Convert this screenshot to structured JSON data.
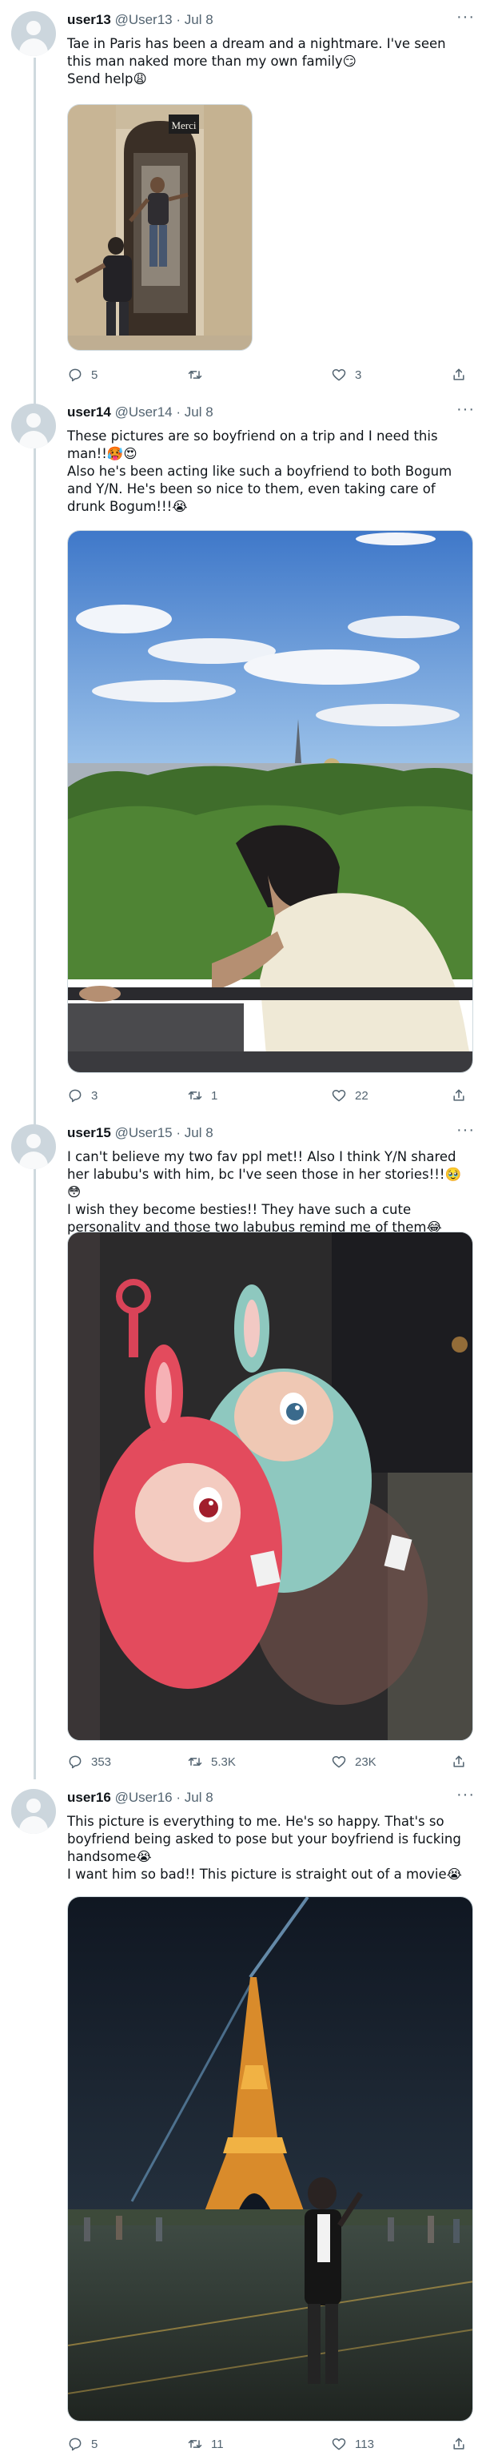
{
  "tweets": [
    {
      "user": "user13",
      "handle": "@User13",
      "date": "Jul 8",
      "text": "Tae in Paris has been a dream and a nightmare. I've seen this man naked more than my own family😏\nSend help😩",
      "image_label": "Merci",
      "stats": {
        "replies": "5",
        "retweets": "",
        "likes": "3"
      }
    },
    {
      "user": "user14",
      "handle": "@User14",
      "date": "Jul 8",
      "text": "These pictures are so boyfriend on a trip and I need this man!!🥵😍\nAlso he's been acting like such a boyfriend to both Bogum and Y/N. He's been so nice to them, even taking care of drunk Bogum!!!😭",
      "stats": {
        "replies": "3",
        "retweets": "1",
        "likes": "22"
      }
    },
    {
      "user": "user15",
      "handle": "@User15",
      "date": "Jul 8",
      "text": "I can't believe my two fav ppl met!! Also I think Y/N shared her labubu's with him, bc I've seen those in her stories!!!🥹😳\nI wish they become besties!! They have such a cute personality and those two labubus remind me of them😂",
      "stats": {
        "replies": "353",
        "retweets": "5.3K",
        "likes": "23K"
      }
    },
    {
      "user": "user16",
      "handle": "@User16",
      "date": "Jul 8",
      "text": "This picture is everything to me. He's so happy. That's so boyfriend being asked to pose but your boyfriend is fucking handsome😭\nI want him so bad!! This picture is straight out of a movie😭",
      "stats": {
        "replies": "5",
        "retweets": "11",
        "likes": "113"
      }
    }
  ],
  "header_separator": "·",
  "more_glyph": "···",
  "icons": [
    "reply-icon",
    "retweet-icon",
    "like-icon",
    "share-icon",
    "more-icon",
    "avatar"
  ],
  "colors": {
    "text": "#0f1419",
    "secondary": "#536471",
    "thread_line": "#cfd9de",
    "avatar_bg": "#ccd6dd"
  }
}
